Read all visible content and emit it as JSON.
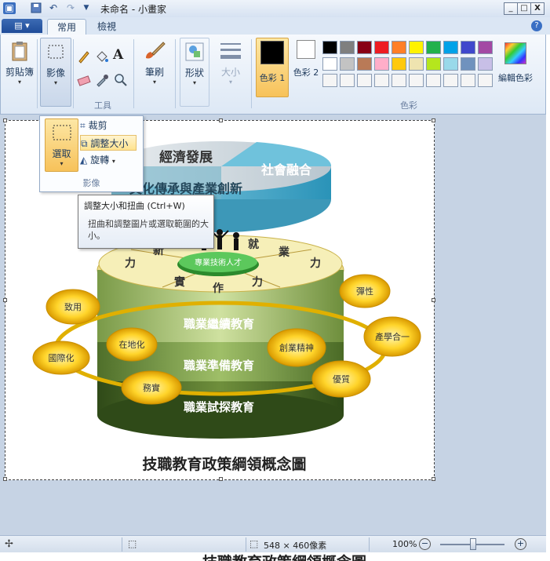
{
  "window": {
    "title": "未命名 - 小畫家",
    "controls": {
      "minimize": "_",
      "maximize": "□",
      "close": "X"
    }
  },
  "quick_access": {
    "save_icon": "save-icon",
    "undo_icon": "undo-icon",
    "redo_icon": "redo-icon",
    "customize_icon": "chevron-down-icon"
  },
  "ribbon": {
    "tabs": [
      {
        "label": "常用",
        "active": true
      },
      {
        "label": "檢視",
        "active": false
      }
    ],
    "clipboard": {
      "label": "剪貼簿"
    },
    "image": {
      "label": "影像"
    },
    "tools": {
      "label": "工具"
    },
    "brushes": {
      "label": "筆刷"
    },
    "shapes": {
      "label": "形狀"
    },
    "size": {
      "label": "大小"
    },
    "color1": {
      "label": "色彩 1",
      "value": "#000000"
    },
    "color2": {
      "label": "色彩 2",
      "value": "#ffffff"
    },
    "edit_colors": {
      "label": "編輯色彩"
    },
    "colors_group": {
      "label": "色彩"
    },
    "palette": [
      [
        "#000000",
        "#7f7f7f",
        "#880015",
        "#ed1c24",
        "#ff7f27",
        "#fff200",
        "#22b14c",
        "#00a2e8",
        "#3f48cc",
        "#a349a4"
      ],
      [
        "#ffffff",
        "#c3c3c3",
        "#b97a57",
        "#ffaec9",
        "#ffc90e",
        "#efe4b0",
        "#b5e61d",
        "#99d9ea",
        "#7092be",
        "#c8bfe7"
      ],
      [
        "#f5f5f5",
        "#f5f5f5",
        "#f5f5f5",
        "#f5f5f5",
        "#f5f5f5",
        "#f5f5f5",
        "#f5f5f5",
        "#f5f5f5",
        "#f5f5f5",
        "#f5f5f5"
      ]
    ]
  },
  "image_menu": {
    "select_label": "選取",
    "crop_label": "裁剪",
    "resize_label": "調整大小",
    "rotate_label": "旋轉",
    "group_label": "影像"
  },
  "tooltip": {
    "title": "調整大小和扭曲 (Ctrl+W)",
    "body": "扭曲和調整圖片或選取範圍的大小。"
  },
  "diagram": {
    "top_left": "經濟發展",
    "top_right": "社會融合",
    "top_front": "文化傳承與產業創新",
    "employ_left": "就",
    "employ_right": "業",
    "power_left_1": "新",
    "power_left_2": "力",
    "power_right": "力",
    "practice_1": "實",
    "practice_2": "作",
    "practice_3": "力",
    "center_platform": "專業技術人才",
    "layer_1": "職業繼續教育",
    "layer_2": "職業準備教育",
    "layer_3": "職業試探教育",
    "oval_yongzhi": "致用",
    "oval_local": "在地化",
    "oval_intl": "國際化",
    "oval_practical": "務實",
    "oval_flex": "彈性",
    "oval_industry": "產學合一",
    "oval_spirit": "創業精神",
    "oval_quality": "優質",
    "caption": "技職教育政策綱領概念圖"
  },
  "statusbar": {
    "canvas_size": "548 × 460像素",
    "zoom": "100%"
  },
  "bottom_partial_text": "技職教育政策綱領概念圖"
}
